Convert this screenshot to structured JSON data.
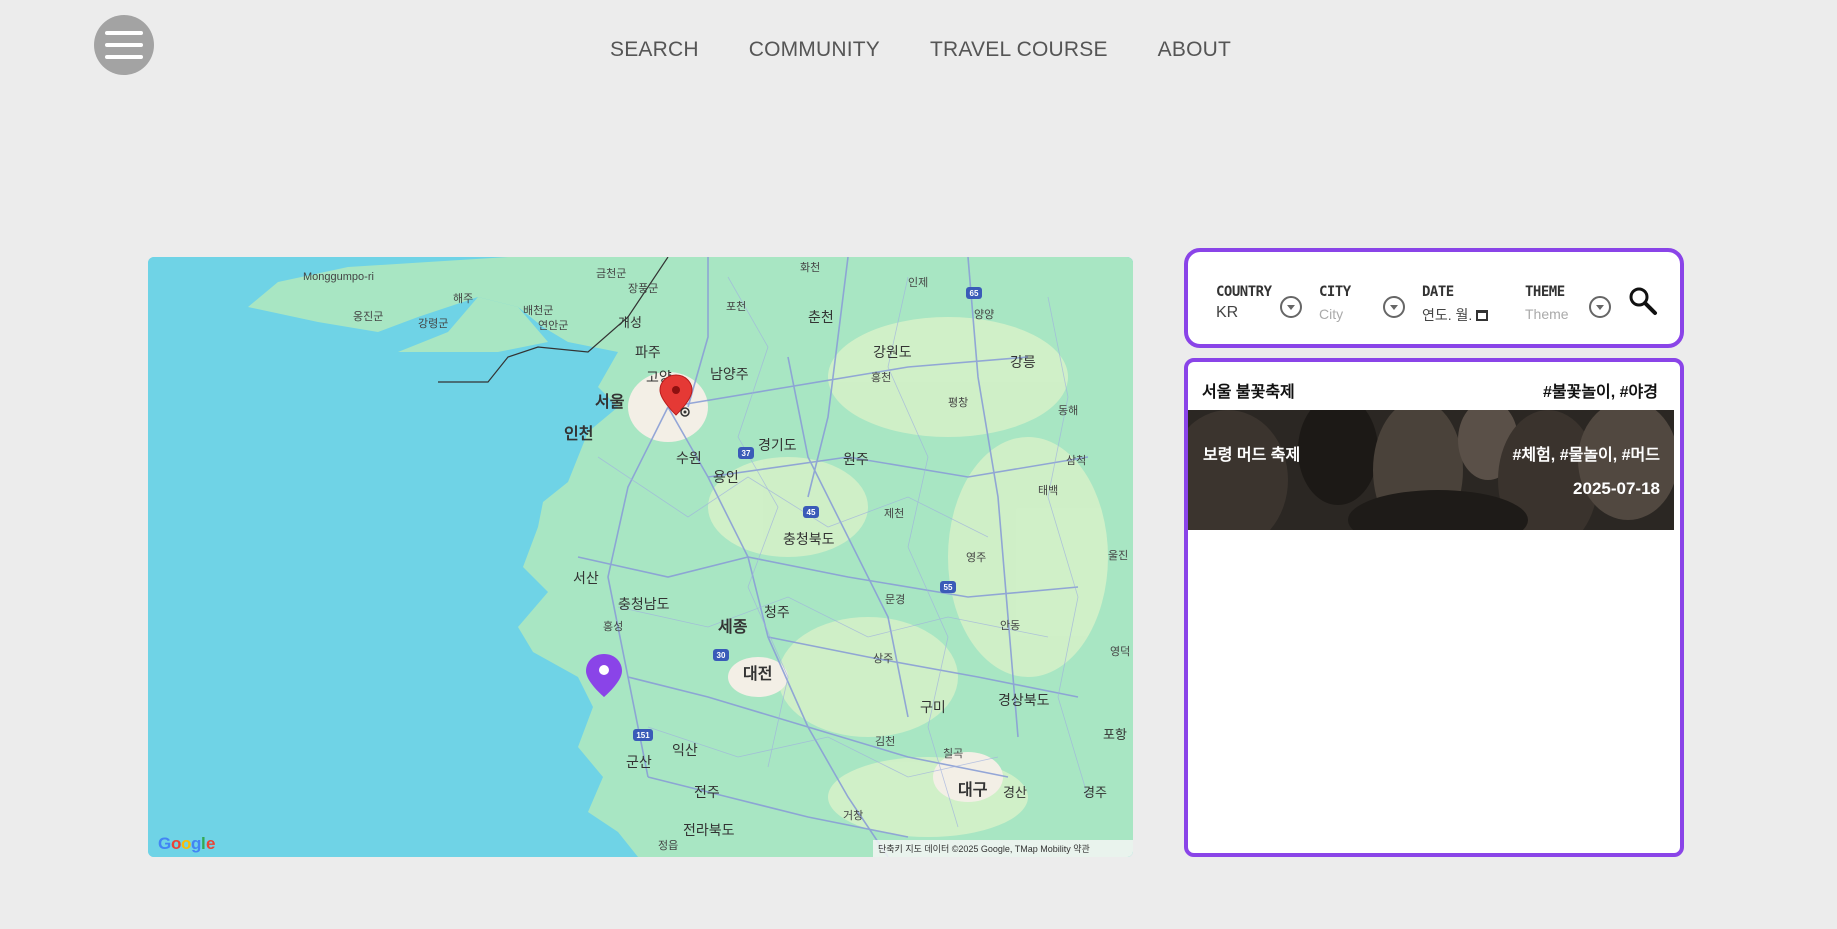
{
  "nav": {
    "items": [
      "SEARCH",
      "COMMUNITY",
      "TRAVEL COURSE",
      "ABOUT"
    ]
  },
  "map": {
    "labels": {
      "seoul": "서울",
      "incheon": "인천",
      "gyeonggi": "경기도",
      "gangwon": "강원도",
      "chungbuk": "충청북도",
      "chungnam": "충청남도",
      "gyeongbuk": "경상북도",
      "jeonbuk": "전라북도",
      "sejong": "세종",
      "daejeon": "대전",
      "daegu": "대구",
      "suwon": "수원",
      "chuncheon": "춘천",
      "wonju": "원주",
      "gangneung": "강릉",
      "pohang": "포항",
      "gumi": "구미",
      "gunsan": "군산",
      "jeonju": "전주",
      "iksan": "익산",
      "seosan": "서산",
      "cheongju": "청주",
      "yongin": "용인",
      "goyang": "고양",
      "paju": "파주",
      "gaeseong": "개성",
      "namyangju": "남양주",
      "gyeongju": "경주",
      "gyeongsan": "경산",
      "monggumpo": "Monggumpo-ri",
      "haeju": "해주",
      "ongjin": "옹진군",
      "gangnyeong": "강령군",
      "baecheon": "배천군",
      "yeonan": "연안군",
      "geumcheon": "금천군",
      "jangpung": "장풍군",
      "hwacheon": "화천",
      "inje": "인제",
      "yangyang": "양양",
      "hongcheon": "홍천",
      "pyeongchang": "평창",
      "donghae": "동해",
      "samcheok": "삼척",
      "taebaek": "태백",
      "jecheon": "제천",
      "yeongju": "영주",
      "uljin": "울진",
      "mungyeong": "문경",
      "andong": "안동",
      "yeongdeok": "영덕",
      "sangju": "상주",
      "gimcheon": "김천",
      "chilgok": "칠곡",
      "geochang": "거창",
      "jeongeup": "정읍",
      "hongseong": "홍성",
      "pocheon": "포천"
    },
    "attribution": "단축키   지도 데이터 ©2025 Google, TMap Mobility   약관",
    "logo": "Google"
  },
  "search": {
    "country_label": "COUNTRY",
    "country_value": "KR",
    "city_label": "CITY",
    "city_placeholder": "City",
    "date_label": "DATE",
    "date_value": "연도. 월.",
    "theme_label": "THEME",
    "theme_placeholder": "Theme"
  },
  "results": [
    {
      "title": "서울 불꽃축제",
      "tags": "#불꽃놀이, #야경"
    },
    {
      "title": "보령 머드 축제",
      "tags": "#체험, #물놀이, #머드",
      "date": "2025-07-18"
    }
  ],
  "colors": {
    "accent": "#8a44e8",
    "sea": "#6fd3e6",
    "land": "#a8e6c3",
    "marker_red": "#e53935",
    "marker_purple": "#8a44e8"
  }
}
